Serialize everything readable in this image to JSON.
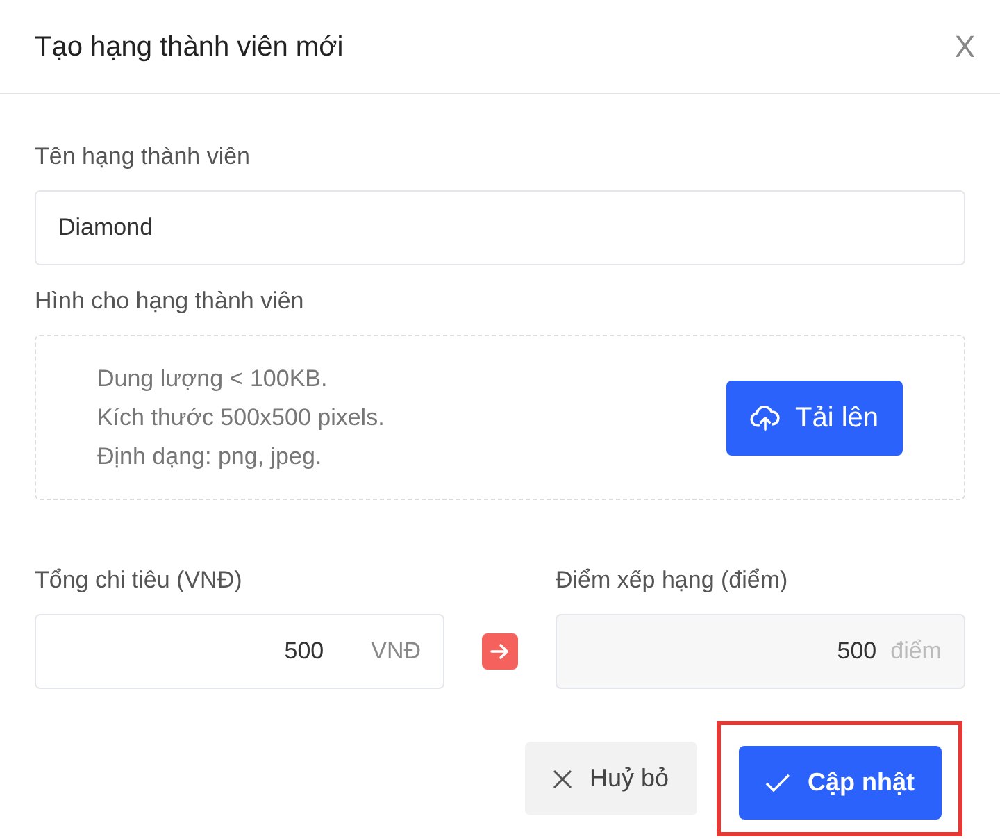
{
  "dialog": {
    "title": "Tạo hạng thành viên mới",
    "close_symbol": "X"
  },
  "name_field": {
    "label": "Tên hạng thành viên",
    "value": "Diamond"
  },
  "image_upload": {
    "label": "Hình cho hạng thành viên",
    "hints": [
      "Dung lượng < 100KB.",
      "Kích thước 500x500 pixels.",
      "Định dạng: png, jpeg."
    ],
    "button": "Tải lên"
  },
  "spending_field": {
    "label": "Tổng chi tiêu (VNĐ)",
    "value": "500",
    "unit": "VNĐ",
    "disabled": false
  },
  "points_field": {
    "label": "Điểm xếp hạng (điểm)",
    "value": "500",
    "unit": "điểm",
    "disabled": true
  },
  "buttons": [
    {
      "kind": "cancel",
      "label": "Huỷ bỏ",
      "highlighted": false
    },
    {
      "kind": "confirm",
      "label": "Cập nhật",
      "highlighted": true
    }
  ]
}
